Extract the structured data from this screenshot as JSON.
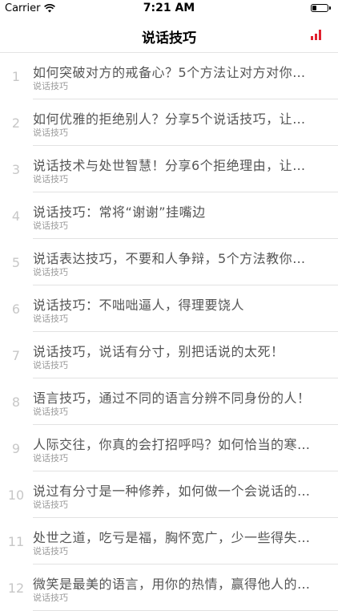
{
  "status_bar": {
    "carrier": "Carrier",
    "time": "7:21 AM"
  },
  "nav": {
    "title": "说话技巧",
    "chart_icon": "bar-chart-icon",
    "accent": "#e0212f"
  },
  "articles": [
    {
      "index": "1",
      "title": "如何突破对方的戒备心？5个方法让对方对你…",
      "category": "说话技巧"
    },
    {
      "index": "2",
      "title": "如何优雅的拒绝别人？分享5个说话技巧，让…",
      "category": "说话技巧"
    },
    {
      "index": "3",
      "title": "说话技术与处世智慧！分享6个拒绝理由，让…",
      "category": "说话技巧"
    },
    {
      "index": "4",
      "title": "说话技巧：常将“谢谢”挂嘴边",
      "category": "说话技巧"
    },
    {
      "index": "5",
      "title": "说话表达技巧，不要和人争辩，5个方法教你…",
      "category": "说话技巧"
    },
    {
      "index": "6",
      "title": "说话技巧：不咄咄逼人，得理要饶人",
      "category": "说话技巧"
    },
    {
      "index": "7",
      "title": "说话技巧，说话有分寸，别把话说的太死！",
      "category": "说话技巧"
    },
    {
      "index": "8",
      "title": "语言技巧，通过不同的语言分辨不同身份的人！",
      "category": "说话技巧"
    },
    {
      "index": "9",
      "title": "人际交往，你真的会打招呼吗？如何恰当的寒…",
      "category": "说话技巧"
    },
    {
      "index": "10",
      "title": "说过有分寸是一种修养，如何做一个会说话的…",
      "category": "说话技巧"
    },
    {
      "index": "11",
      "title": "处世之道，吃亏是福，胸怀宽广，少一些得失…",
      "category": "说话技巧"
    },
    {
      "index": "12",
      "title": "微笑是最美的语言，用你的热情，赢得他人的…",
      "category": "说话技巧"
    }
  ]
}
